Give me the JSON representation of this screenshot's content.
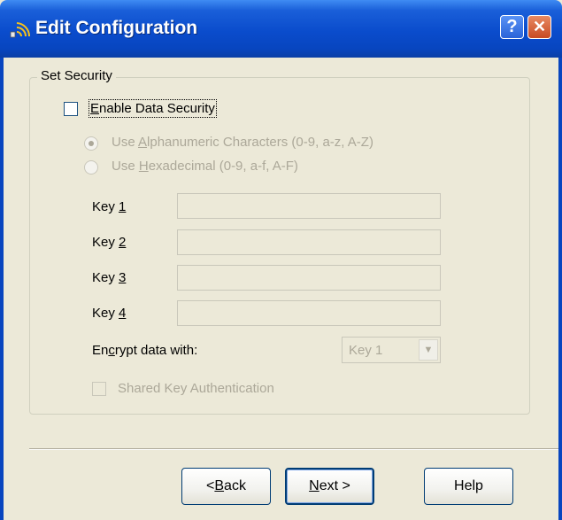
{
  "window": {
    "title": "Edit Configuration",
    "help_glyph": "?",
    "close_glyph": "✕",
    "title_icon": "wireless-signal-icon"
  },
  "group": {
    "legend": "Set Security",
    "enable_security": {
      "pre": "",
      "key": "E",
      "post": "nable Data Security",
      "checked": false
    },
    "radio_alnum": {
      "pre": "Use ",
      "key": "A",
      "post": "lphanumeric Characters (0-9, a-z, A-Z)",
      "selected": true
    },
    "radio_hex": {
      "pre": "Use ",
      "key": "H",
      "post": "exadecimal (0-9, a-f, A-F)",
      "selected": false
    },
    "keys": [
      {
        "pre": "Key ",
        "key": "1",
        "value": ""
      },
      {
        "pre": "Key ",
        "key": "2",
        "value": ""
      },
      {
        "pre": "Key ",
        "key": "3",
        "value": ""
      },
      {
        "pre": "Key ",
        "key": "4",
        "value": ""
      }
    ],
    "encrypt": {
      "pre": "En",
      "key": "c",
      "post": "rypt data with:",
      "selected": "Key 1"
    },
    "shared_key": {
      "label": "Shared Key Authentication",
      "checked": false
    }
  },
  "buttons": {
    "back": {
      "pre": "< ",
      "key": "B",
      "post": "ack"
    },
    "next": {
      "key": "N",
      "post": "ext >"
    },
    "help": "Help"
  },
  "colors": {
    "titlebar": "#0a4ccc",
    "dialog_bg": "#ece9d8",
    "disabled_text": "#aca899",
    "close_button": "#c84a22"
  }
}
